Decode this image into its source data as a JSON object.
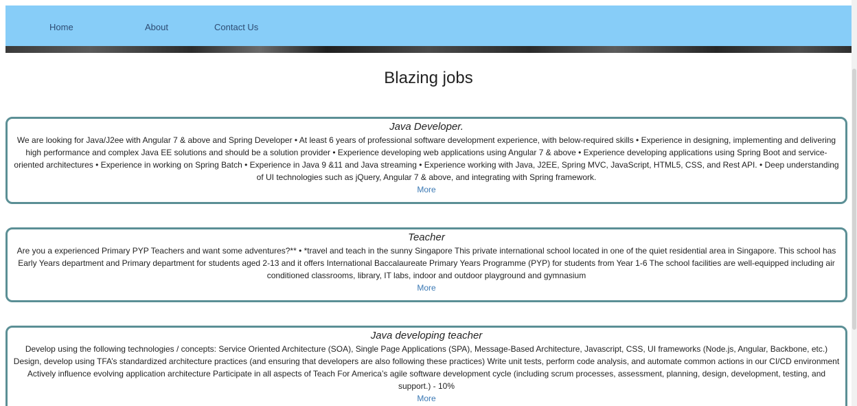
{
  "nav": {
    "items": [
      {
        "label": "Home"
      },
      {
        "label": "About"
      },
      {
        "label": "Contact Us"
      }
    ]
  },
  "page": {
    "title": "Blazing jobs"
  },
  "jobs": [
    {
      "title": "Java Developer.",
      "description": "We are looking for Java/J2ee with Angular 7 & above and Spring Developer • At least 6 years of professional software development experience, with below-required skills • Experience in designing, implementing and delivering high performance and complex Java EE solutions and should be a solution provider • Experience developing web applications using Angular 7 & above • Experience developing applications using Spring Boot and service-oriented architectures • Experience in working on Spring Batch • Experience in Java 9 &11 and Java streaming • Experience working with Java, J2EE, Spring MVC, JavaScript, HTML5, CSS, and Rest API. • Deep understanding of UI technologies such as jQuery, Angular 7 & above, and integrating with Spring framework.",
      "more_label": "More"
    },
    {
      "title": "Teacher",
      "description": "Are you a experienced Primary PYP Teachers and want some adventures?** • *travel and teach in the sunny Singapore This private international school located in one of the quiet residential area in Singapore. This school has Early Years department and Primary department for students aged 2-13 and it offers International Baccalaureate Primary Years Programme (PYP) for students from Year 1-6 The school facilities are well-equipped including air conditioned classrooms, library, IT labs, indoor and outdoor playground and gymnasium",
      "more_label": "More"
    },
    {
      "title": "Java developing teacher",
      "description": "Develop using the following technologies / concepts: Service Oriented Architecture (SOA), Single Page Applications (SPA), Message-Based Architecture, Javascript, CSS, UI frameworks (Node.js, Angular, Backbone, etc.) Design, develop using TFA’s standardized architecture practices (and ensuring that developers are also following these practices) Write unit tests, perform code analysis, and automate common actions in our CI/CD environment Actively influence evolving application architecture Participate in all aspects of Teach For America’s agile software development cycle (including scrum processes, assessment, planning, design, development, testing, and support.) - 10%",
      "more_label": "More"
    }
  ]
}
